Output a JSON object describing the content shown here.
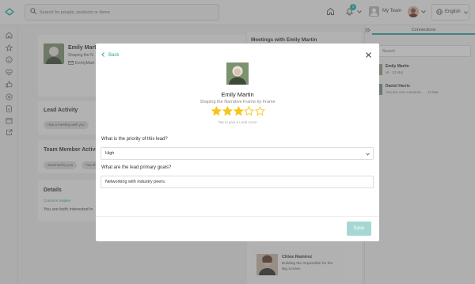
{
  "header": {
    "search_placeholder": "Search for people, products or items",
    "notification_count": "1",
    "team_label": "My Team",
    "language": "English"
  },
  "background": {
    "profile_name": "Emily Martin",
    "profile_tagline": "Shaping the N",
    "profile_email": "EmilyMart",
    "lead_activity_title": "Lead Activity",
    "lead_activity_chip": "Has a meeting with you",
    "team_activity_title": "Team Member Activity",
    "team_activity_chips": [
      "Scanned by you",
      "You sh"
    ],
    "details_title": "Details",
    "details_link": "Common Swipes",
    "details_text": "You are both interested in",
    "meetings_title": "Meetings with Emily Martin",
    "meeting_name": "Chloe Ramirez",
    "meeting_desc": "Building the Impossible for the Big Screen"
  },
  "connections": {
    "tab_label": "Connections",
    "search_placeholder": "Search",
    "items": [
      {
        "name": "Emily Martin",
        "sub": "Hi · 13 Mar"
      },
      {
        "name": "Daniel Harris",
        "sub": "You are now connecte… · 12 Mar"
      }
    ]
  },
  "modal": {
    "back_label": "Back",
    "name": "Emily Martin",
    "tagline": "Shaping the Narrative Frame by Frame",
    "rating": 3,
    "rating_max": 5,
    "rating_hint": "Tap to give a Lead score",
    "priority_question": "What is the priority of this lead?",
    "priority_value": "High",
    "goals_question": "What are the lead primary goals?",
    "goals_value": "Networking with industry peers.",
    "save_label": "Save"
  },
  "colors": {
    "accent": "#2aa7a0",
    "star": "#f5c518",
    "save_disabled": "#a6d8d3"
  },
  "icons": {
    "sidebar": [
      "home-icon",
      "star-icon",
      "smiley-icon",
      "heart-pulse-icon",
      "thumbs-up-icon",
      "close-circle-icon",
      "document-check-icon",
      "calendar-icon",
      "external-link-icon"
    ]
  }
}
